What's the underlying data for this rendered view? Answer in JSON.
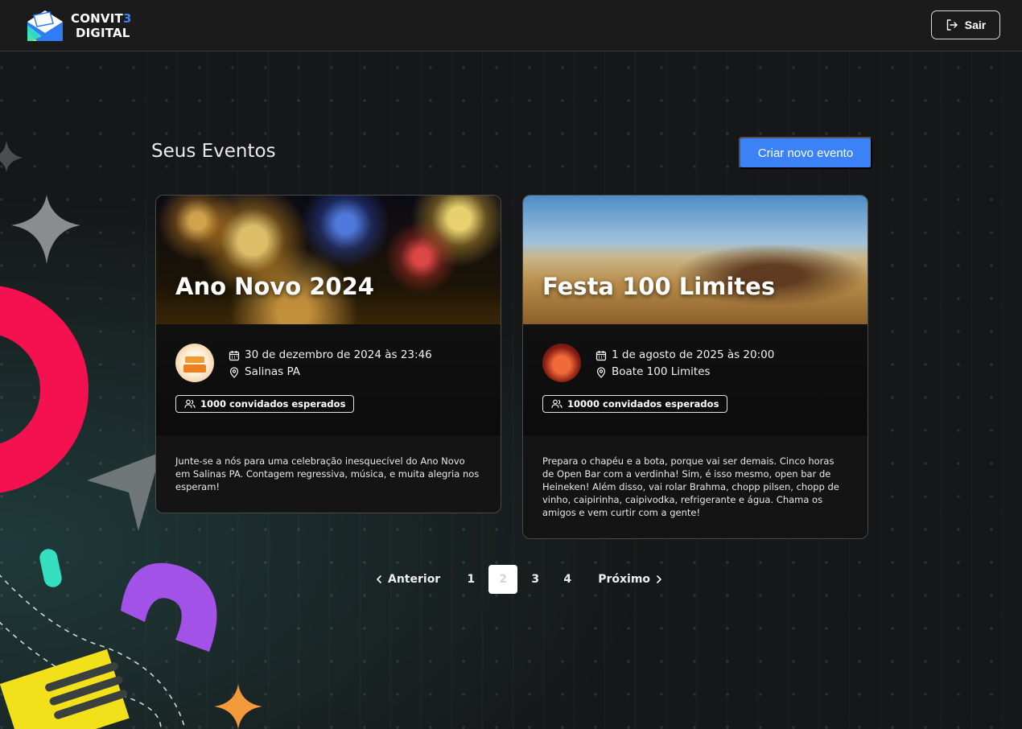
{
  "header": {
    "logo_line1": "CONVIT",
    "logo_line1_accent": "3",
    "logo_line2": "DIGITAL",
    "exit_label": "Sair"
  },
  "main": {
    "title": "Seus Eventos",
    "create_button": "Criar novo evento"
  },
  "events": [
    {
      "title": "Ano Novo 2024",
      "datetime": "30 de dezembro de 2024 às 23:46",
      "location": "Salinas PA",
      "guests": "1000 convidados esperados",
      "description": "Junte-se a nós para uma celebração inesquecível do Ano Novo em Salinas PA. Contagem regressiva, música, e muita alegria nos esperam!"
    },
    {
      "title": "Festa 100 Limites",
      "datetime": "1 de agosto de 2025 às 20:00",
      "location": "Boate 100 Limites",
      "guests": "10000 convidados esperados",
      "description": "Prepara o chapéu e a bota, porque vai ser demais. Cinco horas de Open Bar com a verdinha! Sim, é isso mesmo, open bar de Heineken! Além disso, vai rolar Brahma, chopp pilsen, chopp de vinho, caipirinha, caipivodka, refrigerante e água. Chama os amigos e vem curtir com a gente!"
    }
  ],
  "pagination": {
    "prev": "Anterior",
    "next": "Próximo",
    "pages": [
      "1",
      "2",
      "3",
      "4"
    ],
    "current": "2"
  },
  "colors": {
    "accent": "#3b82f6",
    "background": "#161718",
    "card": "#121212"
  },
  "icons": [
    "logout-icon",
    "calendar-icon",
    "location-pin-icon",
    "users-icon",
    "chevron-left-icon",
    "chevron-right-icon"
  ]
}
